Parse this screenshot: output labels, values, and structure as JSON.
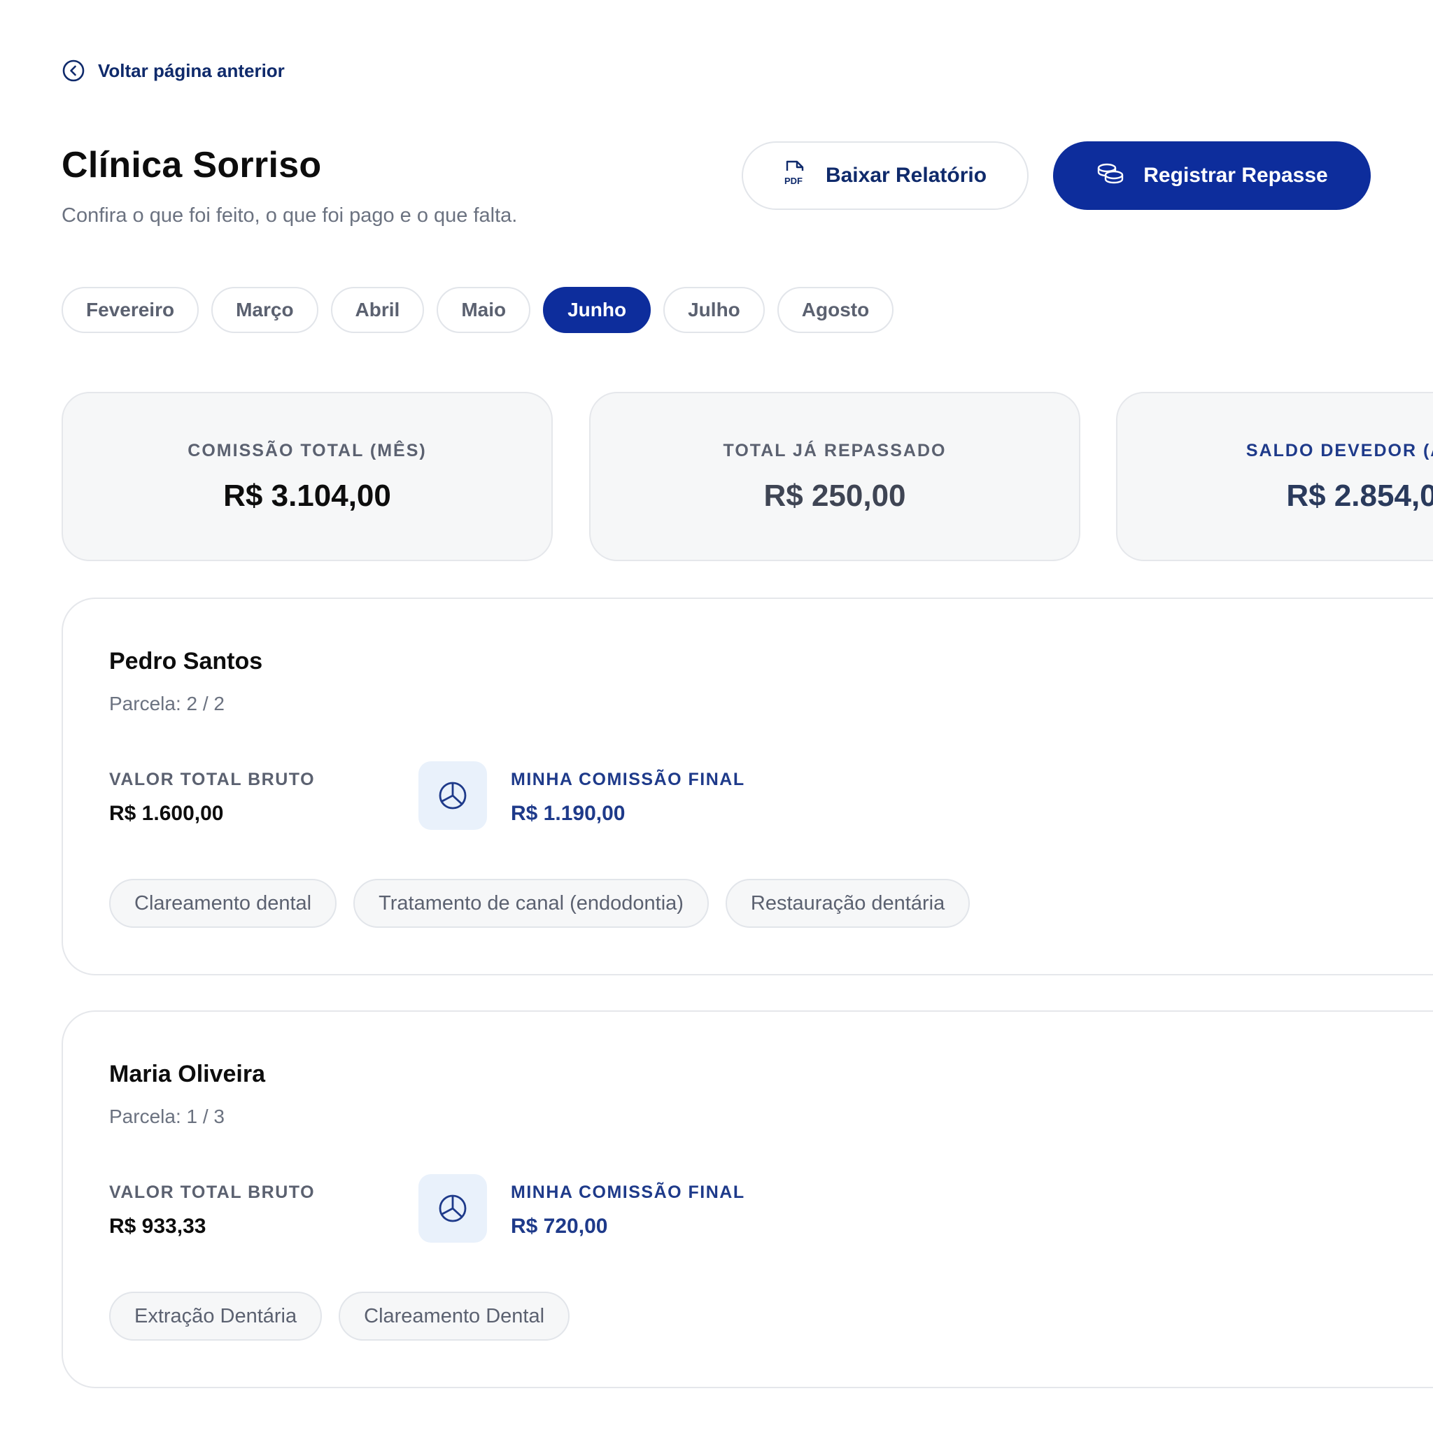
{
  "nav": {
    "back_label": "Voltar página anterior",
    "back_icon": "chevron-left-circle-icon"
  },
  "header": {
    "title": "Clínica Sorriso",
    "subtitle": "Confira o que foi feito, o que foi pago e o que falta."
  },
  "actions": {
    "download_label": "Baixar Relatório",
    "download_icon": "pdf-file-icon",
    "register_label": "Registrar Repasse",
    "register_icon": "coins-icon"
  },
  "months": {
    "items": [
      "Fevereiro",
      "Março",
      "Abril",
      "Maio",
      "Junho",
      "Julho",
      "Agosto"
    ],
    "selected": "Junho"
  },
  "summary": {
    "commission_total": {
      "label": "COMISSÃO TOTAL (MÊS)",
      "value": "R$ 3.104,00"
    },
    "total_transferred": {
      "label": "TOTAL JÁ REPASSADO",
      "value": "R$ 250,00"
    },
    "balance_due": {
      "label": "SALDO DEVEDOR (A RE",
      "value": "R$ 2.854,0"
    }
  },
  "patients": [
    {
      "name": "Pedro Santos",
      "installment": "Parcela: 2 / 2",
      "gross_label": "VALOR TOTAL BRUTO",
      "gross_value": "R$ 1.600,00",
      "commission_label": "MINHA COMISSÃO FINAL",
      "commission_value": "R$ 1.190,00",
      "procedures": [
        "Clareamento dental",
        "Tratamento de canal (endodontia)",
        "Restauração dentária"
      ]
    },
    {
      "name": "Maria Oliveira",
      "installment": "Parcela: 1 / 3",
      "gross_label": "VALOR TOTAL BRUTO",
      "gross_value": "R$ 933,33",
      "commission_label": "MINHA COMISSÃO FINAL",
      "commission_value": "R$ 720,00",
      "procedures": [
        "Extração Dentária",
        "Clareamento Dental"
      ]
    }
  ],
  "colors": {
    "primary": "#0d2d9c",
    "accent_text": "#1e3a8a",
    "muted_text": "#6b7280",
    "icon_bg": "#e9f1fb"
  }
}
